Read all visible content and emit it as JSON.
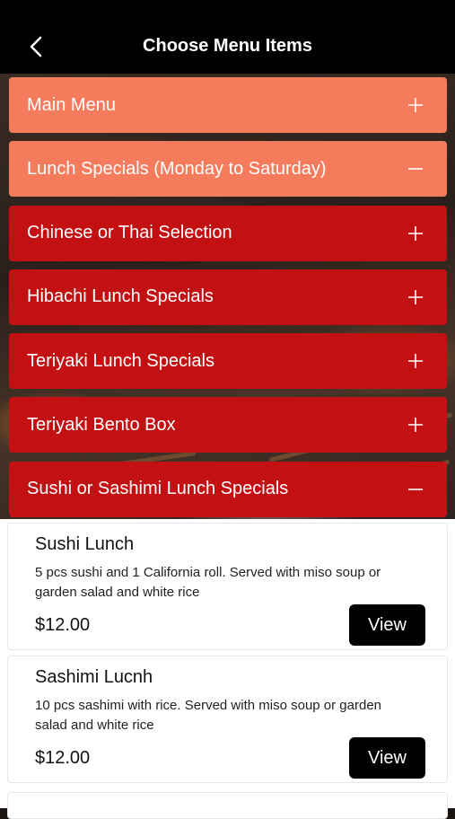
{
  "header": {
    "title": "Choose Menu Items"
  },
  "categories": [
    {
      "label": "Main Menu",
      "expanded": false
    },
    {
      "label": "Lunch Specials (Monday to Saturday)",
      "expanded": true
    },
    {
      "label": "Chinese or Thai Selection",
      "expanded": false
    },
    {
      "label": "Hibachi Lunch Specials",
      "expanded": false
    },
    {
      "label": "Teriyaki Lunch Specials",
      "expanded": false
    },
    {
      "label": "Teriyaki Bento Box",
      "expanded": false
    },
    {
      "label": "Sushi or Sashimi Lunch Specials",
      "expanded": true
    }
  ],
  "items": [
    {
      "name": "Sushi Lunch",
      "description": "5 pcs sushi  and 1 California roll. Served with miso soup or garden salad and white rice",
      "price": "$12.00",
      "button": "View"
    },
    {
      "name": "Sashimi Lucnh",
      "description": "10 pcs sashimi with rice. Served with miso soup or garden salad and white rice",
      "price": "$12.00",
      "button": "View"
    }
  ],
  "colors": {
    "header": "#000000",
    "category_light": "#f47c5c",
    "category_dark": "#c31012",
    "button": "#000000"
  }
}
